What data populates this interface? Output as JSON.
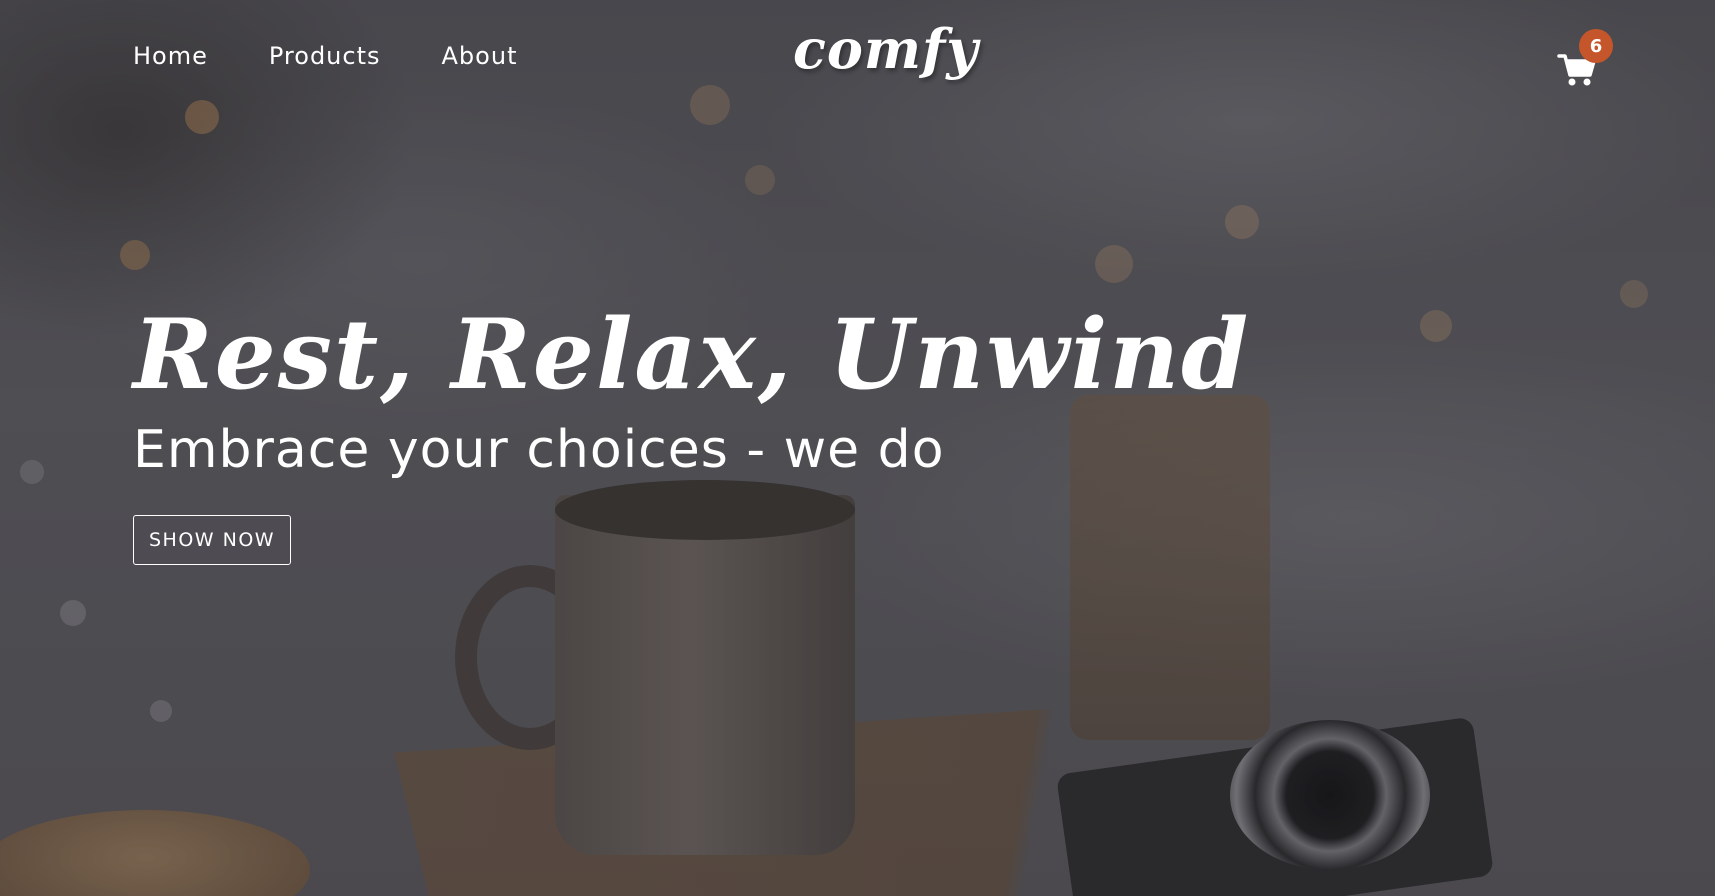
{
  "nav": {
    "links": [
      {
        "label": "Home"
      },
      {
        "label": "Products"
      },
      {
        "label": "About"
      }
    ]
  },
  "logo": {
    "text": "comfy"
  },
  "cart": {
    "icon": "shopping-cart-icon",
    "count": "6",
    "badge_color": "#c5562c"
  },
  "hero": {
    "title": "Rest, Relax, Unwind",
    "subtitle": "Embrace your choices - we do",
    "button_label": "SHOW NOW"
  }
}
